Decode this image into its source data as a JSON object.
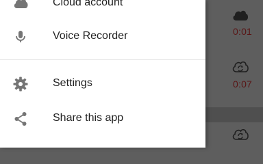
{
  "drawer": {
    "items_top": [
      {
        "label": "Cloud account",
        "icon": "cloud-icon"
      },
      {
        "label": "Voice Recorder",
        "icon": "microphone-icon"
      }
    ],
    "items_bottom": [
      {
        "label": "Settings",
        "icon": "gear-icon"
      },
      {
        "label": "Share this app",
        "icon": "share-icon"
      }
    ]
  },
  "recordings": [
    {
      "duration": "0:01",
      "icon": "cloud-icon"
    },
    {
      "duration": "0:07",
      "icon": "cloud-sync-icon"
    },
    {
      "duration": "",
      "icon": "cloud-sync-icon"
    }
  ],
  "colors": {
    "drawer_bg": "#ffffff",
    "label": "#212121",
    "icon": "#757575",
    "scrim_bg": "#5e5e5e",
    "duration": "#5a1414"
  }
}
